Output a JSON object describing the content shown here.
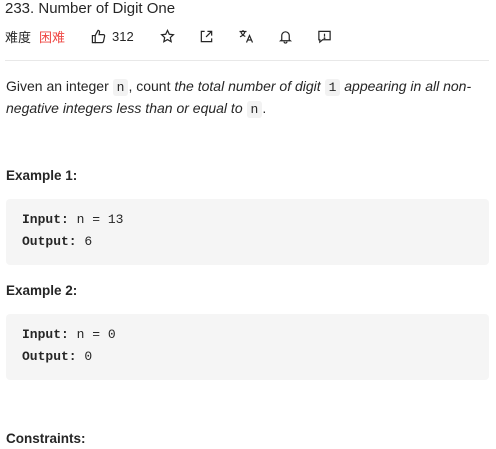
{
  "problem": {
    "title": "233. Number of Digit One",
    "difficulty_label": "难度",
    "difficulty": "困难",
    "likes": "312"
  },
  "description": {
    "p1": "Given an integer ",
    "code_n": "n",
    "p2": ", count ",
    "em1": "the total number of digit ",
    "code_1": "1",
    "em2": " appearing in all non-negative integers less than or equal to ",
    "code_n2": "n",
    "p3": "."
  },
  "examples": [
    {
      "title": "Example 1:",
      "input_label": "Input:",
      "input_value": " n = 13",
      "output_label": "Output:",
      "output_value": " 6"
    },
    {
      "title": "Example 2:",
      "input_label": "Input:",
      "input_value": " n = 0",
      "output_label": "Output:",
      "output_value": " 0"
    }
  ],
  "constraints_title": "Constraints:",
  "icons": [
    "thumbs-up-icon",
    "star-icon",
    "share-icon",
    "translate-icon",
    "bell-icon",
    "feedback-icon"
  ],
  "colors": {
    "difficulty_hard": "#ef4743",
    "code_bg": "#f5f5f5"
  }
}
